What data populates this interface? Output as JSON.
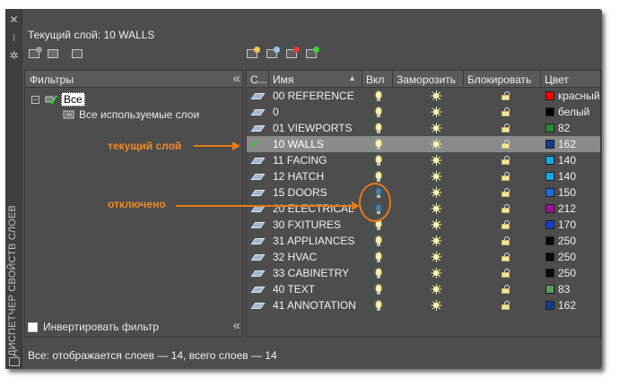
{
  "palette": {
    "vertical_title": "ДИСПЕТЧЕР СВОЙСТВ СЛОЕВ",
    "current_layer_text": "Текущий слой: 10 WALLS",
    "status_text": "Все: отображается слоев — 14, всего слоев — 14"
  },
  "filters": {
    "header": "Фильтры",
    "root_label": "Все",
    "child_label": "Все используемые слои",
    "invert_label": "Инвертировать фильтр",
    "invert_checked": false
  },
  "columns": {
    "status": "С...",
    "name": "Имя",
    "on": "Вкл",
    "freeze": "Заморозить",
    "lock": "Блокировать",
    "color": "Цвет"
  },
  "layers": [
    {
      "name": "00 REFERENCE",
      "on": true,
      "color_name": "красный",
      "color_hex": "#ff0000",
      "current": false
    },
    {
      "name": "0",
      "on": true,
      "color_name": "белый",
      "color_hex": "#000000",
      "current": false
    },
    {
      "name": "01 VIEWPORTS",
      "on": true,
      "color_name": "82",
      "color_hex": "#2e8a2e",
      "current": false
    },
    {
      "name": "10 WALLS",
      "on": true,
      "color_name": "162",
      "color_hex": "#123c8f",
      "current": true
    },
    {
      "name": "11 FACING",
      "on": true,
      "color_name": "140",
      "color_hex": "#1aa8e6",
      "current": false
    },
    {
      "name": "12 HATCH",
      "on": true,
      "color_name": "140",
      "color_hex": "#1aa8e6",
      "current": false
    },
    {
      "name": "15 DOORS",
      "on": false,
      "color_name": "150",
      "color_hex": "#1a6fe0",
      "current": false
    },
    {
      "name": "20 ELECTRICAL",
      "on": false,
      "color_name": "212",
      "color_hex": "#a0129a",
      "current": false
    },
    {
      "name": "30 FXITURES",
      "on": true,
      "color_name": "170",
      "color_hex": "#1640c8",
      "current": false
    },
    {
      "name": "31 APPLIANCES",
      "on": true,
      "color_name": "250",
      "color_hex": "#0a0a0a",
      "current": false
    },
    {
      "name": "32 HVAC",
      "on": true,
      "color_name": "250",
      "color_hex": "#0a0a0a",
      "current": false
    },
    {
      "name": "33 CABINETRY",
      "on": true,
      "color_name": "250",
      "color_hex": "#0a0a0a",
      "current": false
    },
    {
      "name": "40 TEXT",
      "on": true,
      "color_name": "83",
      "color_hex": "#5c9c5c",
      "current": false
    },
    {
      "name": "41 ANNOTATION",
      "on": true,
      "color_name": "162",
      "color_hex": "#123c8f",
      "current": false
    }
  ],
  "annotations": {
    "current_layer": "текущий слой",
    "disabled": "отключено"
  },
  "colors": {
    "accent": "#e77b17",
    "panel_bg": "#4d4d4d",
    "header_bg": "#5a5a5a",
    "selected_row": "#8a8a8a"
  }
}
